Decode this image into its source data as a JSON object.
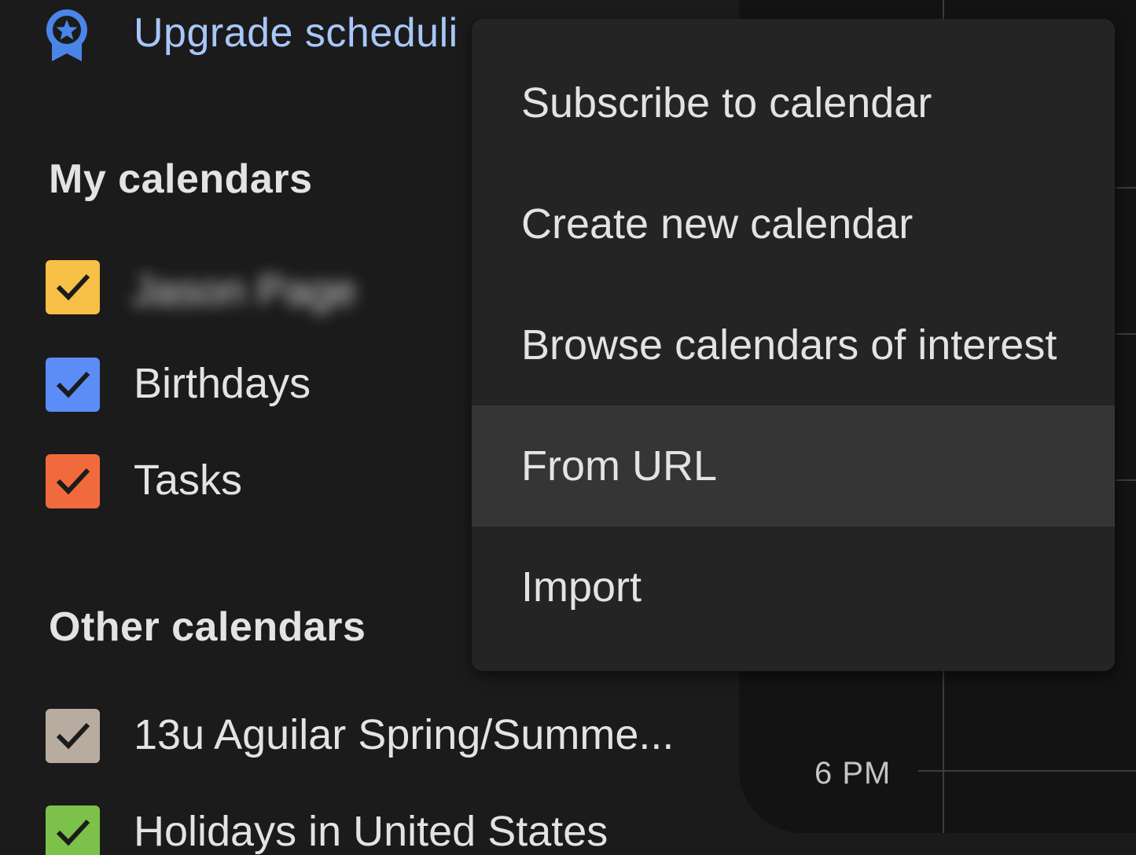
{
  "upgrade": {
    "label": "Upgrade scheduli",
    "icon": "award-badge-icon",
    "color": "#a8c7fa"
  },
  "my_calendars": {
    "header": "My calendars",
    "items": [
      {
        "label": "Jason Page",
        "color": "#f6bf46",
        "checked": true,
        "obscured": true
      },
      {
        "label": "Birthdays",
        "color": "#5c8df6",
        "checked": true
      },
      {
        "label": "Tasks",
        "color": "#f06a3c",
        "checked": true
      }
    ]
  },
  "other_calendars": {
    "header": "Other calendars",
    "items": [
      {
        "label": "13u Aguilar Spring/Summe...",
        "color": "#b8aca0",
        "checked": true
      },
      {
        "label": "Holidays in United States",
        "color": "#7cc24a",
        "checked": true
      }
    ]
  },
  "menu": {
    "items": [
      {
        "label": "Subscribe to calendar"
      },
      {
        "label": "Create new calendar"
      },
      {
        "label": "Browse calendars of interest"
      },
      {
        "label": "From URL",
        "hovered": true
      },
      {
        "label": "Import"
      }
    ]
  },
  "calendar_grid": {
    "time_label": "6 PM"
  }
}
